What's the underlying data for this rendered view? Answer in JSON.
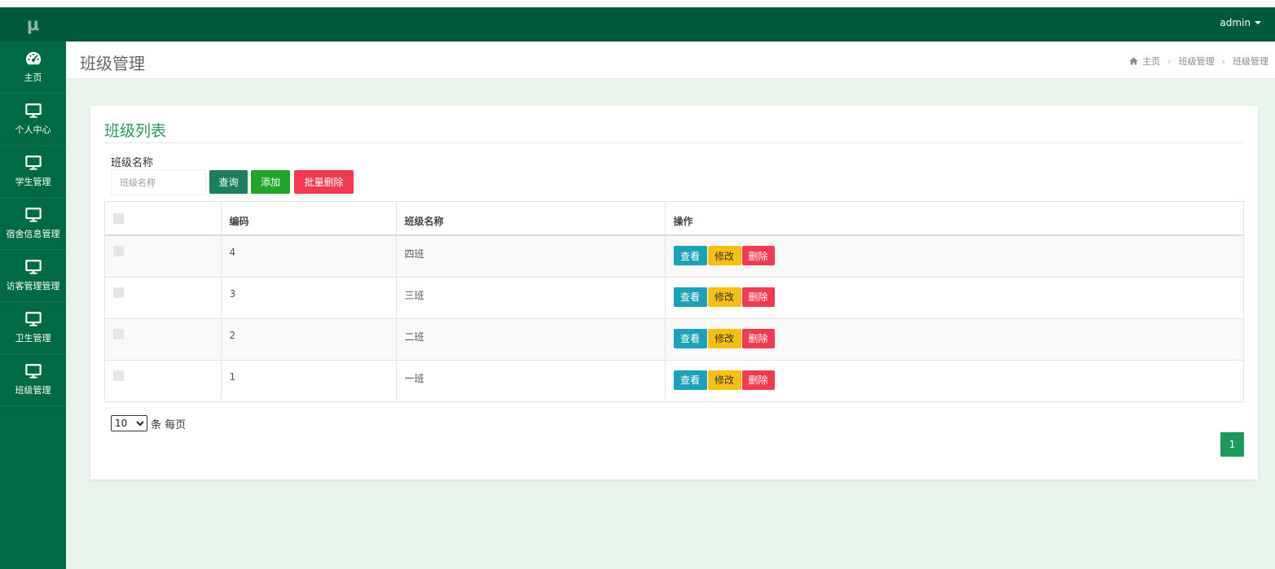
{
  "app": {
    "logo": "μ"
  },
  "header": {
    "user": "admin"
  },
  "sidebar": {
    "items": [
      {
        "label": "主页",
        "icon": "dashboard-icon"
      },
      {
        "label": "个人中心",
        "icon": "monitor-icon"
      },
      {
        "label": "学生管理",
        "icon": "monitor-icon"
      },
      {
        "label": "宿舍信息管理",
        "icon": "monitor-icon"
      },
      {
        "label": "访客管理管理",
        "icon": "monitor-icon"
      },
      {
        "label": "卫生管理",
        "icon": "monitor-icon"
      },
      {
        "label": "班级管理",
        "icon": "monitor-icon"
      }
    ]
  },
  "page": {
    "title": "班级管理",
    "breadcrumb": [
      "主页",
      "班级管理",
      "班级管理"
    ]
  },
  "card": {
    "title": "班级列表",
    "search": {
      "label": "班级名称",
      "placeholder": "班级名称",
      "value": ""
    },
    "buttons": {
      "query": "查询",
      "add": "添加",
      "batch_delete": "批量删除"
    }
  },
  "table": {
    "columns": [
      "",
      "编码",
      "班级名称",
      "操作"
    ],
    "rows": [
      {
        "code": "4",
        "name": "四班"
      },
      {
        "code": "3",
        "name": "三班"
      },
      {
        "code": "2",
        "name": "二班"
      },
      {
        "code": "1",
        "name": "一班"
      }
    ],
    "actions": {
      "view": "查看",
      "edit": "修改",
      "delete": "删除"
    }
  },
  "pagination": {
    "page_size": "10",
    "page_size_suffix": "条 每页",
    "current_page": "1"
  },
  "colors": {
    "sidebar": "#006a45",
    "topbar": "#005a3b",
    "accent": "#2a9a5d",
    "query": "#1c7e5e",
    "add": "#23a52c",
    "danger": "#f43a52",
    "view": "#1ca2b8",
    "edit": "#f9c012"
  }
}
